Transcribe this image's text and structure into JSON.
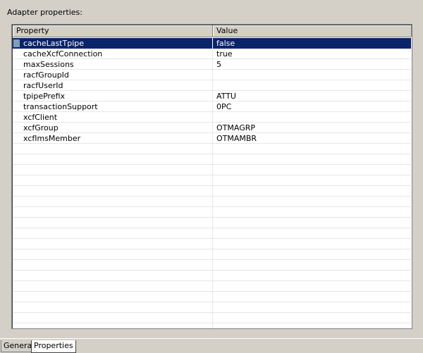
{
  "heading": "Adapter properties:",
  "table": {
    "columns": [
      "Property",
      "Value"
    ],
    "rows": [
      {
        "property": "cacheLastTpipe",
        "value": "false"
      },
      {
        "property": "cacheXcfConnection",
        "value": "true"
      },
      {
        "property": "maxSessions",
        "value": "5"
      },
      {
        "property": "racfGroupId",
        "value": ""
      },
      {
        "property": "racfUserId",
        "value": ""
      },
      {
        "property": "tpipePrefix",
        "value": "ATTU"
      },
      {
        "property": "transactionSupport",
        "value": "0PC"
      },
      {
        "property": "xcfClient",
        "value": ""
      },
      {
        "property": "xcfGroup",
        "value": "OTMAGRP"
      },
      {
        "property": "xcfImsMember",
        "value": "OTMAMBR"
      }
    ],
    "selected_index": 0
  },
  "tabs": [
    "General",
    "Properties"
  ],
  "active_tab": "Properties"
}
